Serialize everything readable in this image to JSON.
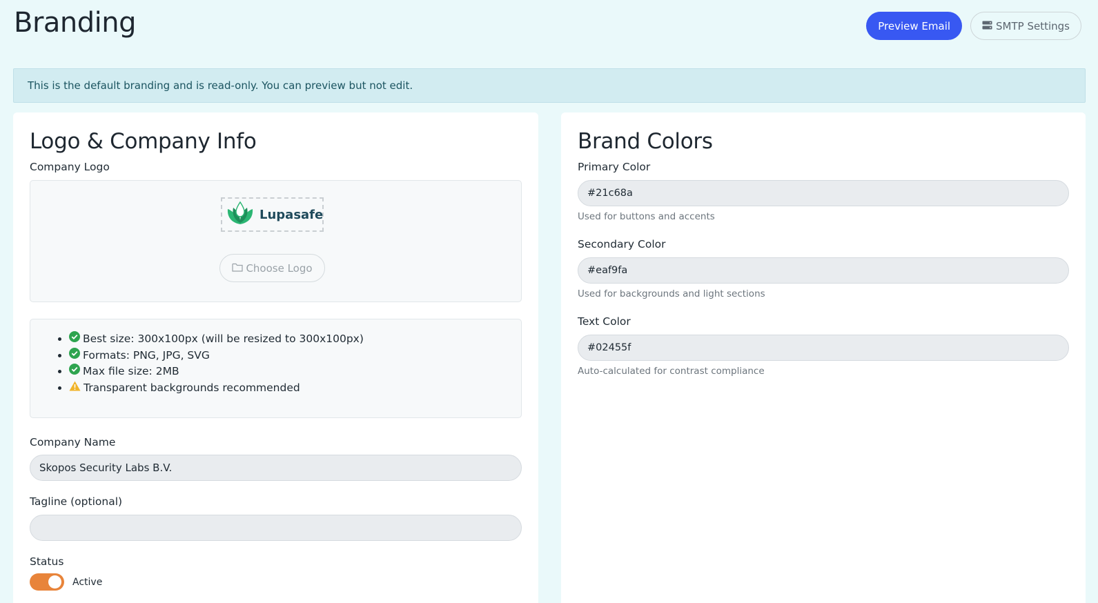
{
  "page": {
    "title": "Branding",
    "preview_email_label": "Preview Email",
    "smtp_settings_label": "SMTP Settings",
    "alert_text": "This is the default branding and is read-only. You can preview but not edit."
  },
  "logo_section": {
    "title": "Logo & Company Info",
    "company_logo_label": "Company Logo",
    "logo_text": "Lupasafe",
    "choose_logo_label": "Choose Logo",
    "guidelines": [
      {
        "icon": "check-circle-icon",
        "text": "Best size: 300x100px (will be resized to 300x100px)"
      },
      {
        "icon": "check-circle-icon",
        "text": "Formats: PNG, JPG, SVG"
      },
      {
        "icon": "check-circle-icon",
        "text": "Max file size: 2MB"
      },
      {
        "icon": "warning-icon",
        "text": "Transparent backgrounds recommended"
      }
    ],
    "company_name_label": "Company Name",
    "company_name_value": "Skopos Security Labs B.V.",
    "tagline_label": "Tagline (optional)",
    "tagline_value": "",
    "status_label": "Status",
    "status_value": "Active",
    "status_on": true
  },
  "colors_section": {
    "title": "Brand Colors",
    "primary_label": "Primary Color",
    "primary_value": "#21c68a",
    "primary_help": "Used for buttons and accents",
    "secondary_label": "Secondary Color",
    "secondary_value": "#eaf9fa",
    "secondary_help": "Used for backgrounds and light sections",
    "text_label": "Text Color",
    "text_value": "#02455f",
    "text_help": "Auto-calculated for contrast compliance"
  },
  "theme": {
    "background": "#eaf9fa",
    "primary_button": "#3858f2",
    "toggle_color": "#e8843a",
    "check_color": "#2ea44f",
    "warning_color": "#f0b429"
  }
}
